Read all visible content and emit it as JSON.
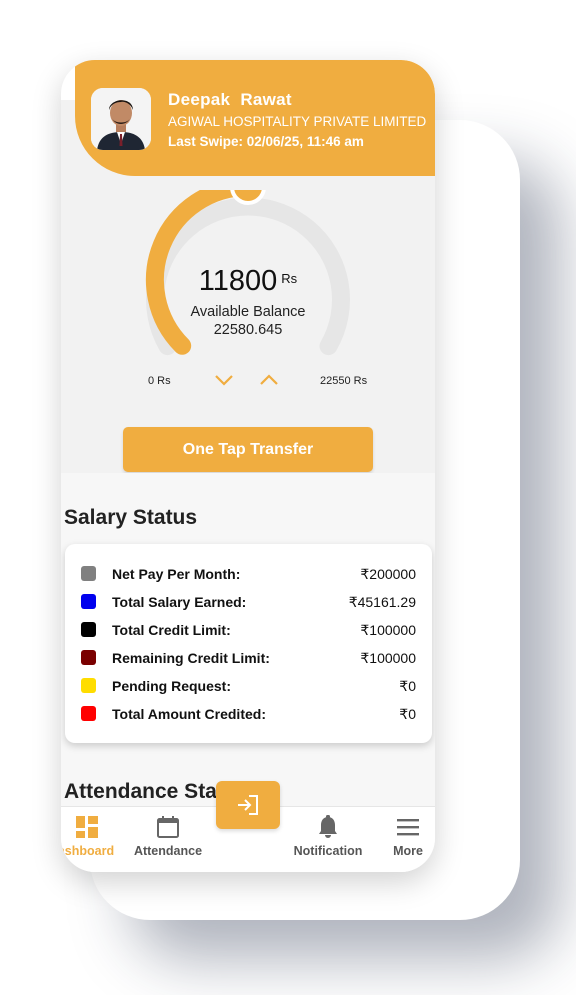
{
  "header": {
    "name": "Deepak  Rawat",
    "company": "AGIWAL HOSPITALITY PRIVATE LIMITED",
    "last_swipe": "Last Swipe: 02/06/25, 11:46 am"
  },
  "balance": {
    "value": "11800",
    "unit": "Rs",
    "label": "Available Balance",
    "secondary": "22580.645",
    "min_label": "0 Rs",
    "max_label": "22550 Rs",
    "gauge_fraction": 0.5
  },
  "transfer_button": "One Tap Transfer",
  "salary_status": {
    "title": "Salary Status",
    "rows": [
      {
        "label": "Net Pay Per Month:",
        "value": "₹200000",
        "color": "#808080"
      },
      {
        "label": "Total Salary Earned:",
        "value": "₹45161.29",
        "color": "#0000ee"
      },
      {
        "label": "Total Credit Limit:",
        "value": "₹100000",
        "color": "#000000"
      },
      {
        "label": "Remaining Credit Limit:",
        "value": "₹100000",
        "color": "#7a0000"
      },
      {
        "label": "Pending Request:",
        "value": "₹0",
        "color": "#ffdd00"
      },
      {
        "label": "Total Amount Credited:",
        "value": "₹0",
        "color": "#ff0000"
      }
    ]
  },
  "attendance_title": "Attendance Sta",
  "nav": {
    "dashboard": "ashboard",
    "attendance": "Attendance",
    "notification": "Notification",
    "more": "More"
  },
  "colors": {
    "accent": "#f0ad40",
    "gauge_track": "#e6e6e6"
  }
}
